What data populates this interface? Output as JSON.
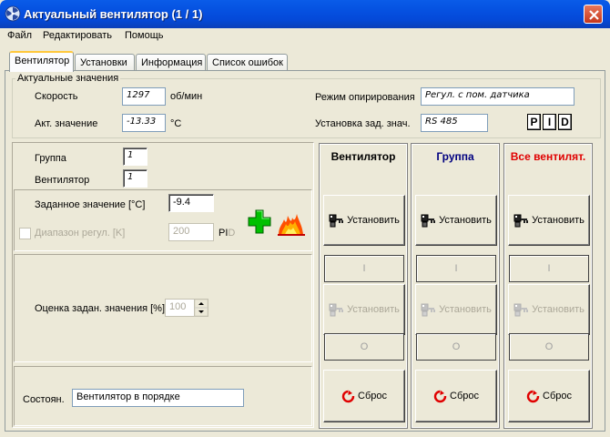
{
  "window": {
    "title": "Актуальный вентилятор  (1 / 1)"
  },
  "menu": [
    {
      "label": "Файл"
    },
    {
      "label": "Редактировать"
    },
    {
      "label": "Помощь"
    }
  ],
  "tabs": [
    {
      "label": "Вентилятор",
      "active": true
    },
    {
      "label": "Установки",
      "active": false
    },
    {
      "label": "Информация",
      "active": false
    },
    {
      "label": "Список ошибок",
      "active": false
    }
  ],
  "actual": {
    "group_title": "Актуальные значения",
    "speed_label": "Скорость",
    "speed_value": "1297",
    "speed_unit": "об/мин",
    "actvalue_label": "Акт. значение",
    "actvalue_value": "-13.33",
    "actvalue_unit": "°C",
    "mode_label": "Режим опирирования",
    "mode_value": "Регул. с пом. датчика",
    "setpoint_src_label": "Установка зад. знач.",
    "setpoint_src_value": "RS 485",
    "pid_letters": [
      "P",
      "I",
      "D"
    ]
  },
  "selection": {
    "group_label": "Группа",
    "group_value": "1",
    "fan_label": "Вентилятор",
    "fan_value": "1"
  },
  "setpoint": {
    "label": "Заданное значение [°C]",
    "value": "-9.4",
    "range_label": "Диапазон регул. [K]",
    "range_value": "200",
    "range_checked": false,
    "pid_text": "PI",
    "pid_text_d": "D",
    "plus_icon": "green-plus-icon",
    "flame_icon": "flame-icon"
  },
  "estimate": {
    "label": "Оценка задан. значения [%]",
    "value": "100"
  },
  "status": {
    "label": "Состоян.",
    "value": "Вентилятор в порядке"
  },
  "columns": [
    {
      "header": "Вентилятор",
      "color": "#000000",
      "set_label": "Установить",
      "i_label": "I",
      "set2_label": "Установить",
      "o_label": "O",
      "reset_label": "Сброс"
    },
    {
      "header": "Группа",
      "color": "#000080",
      "set_label": "Установить",
      "i_label": "I",
      "set2_label": "Установить",
      "o_label": "O",
      "reset_label": "Сброс"
    },
    {
      "header": "Все вентилят.",
      "color": "#e00000",
      "set_label": "Установить",
      "i_label": "I",
      "set2_label": "Установить",
      "o_label": "O",
      "reset_label": "Сброс"
    }
  ]
}
